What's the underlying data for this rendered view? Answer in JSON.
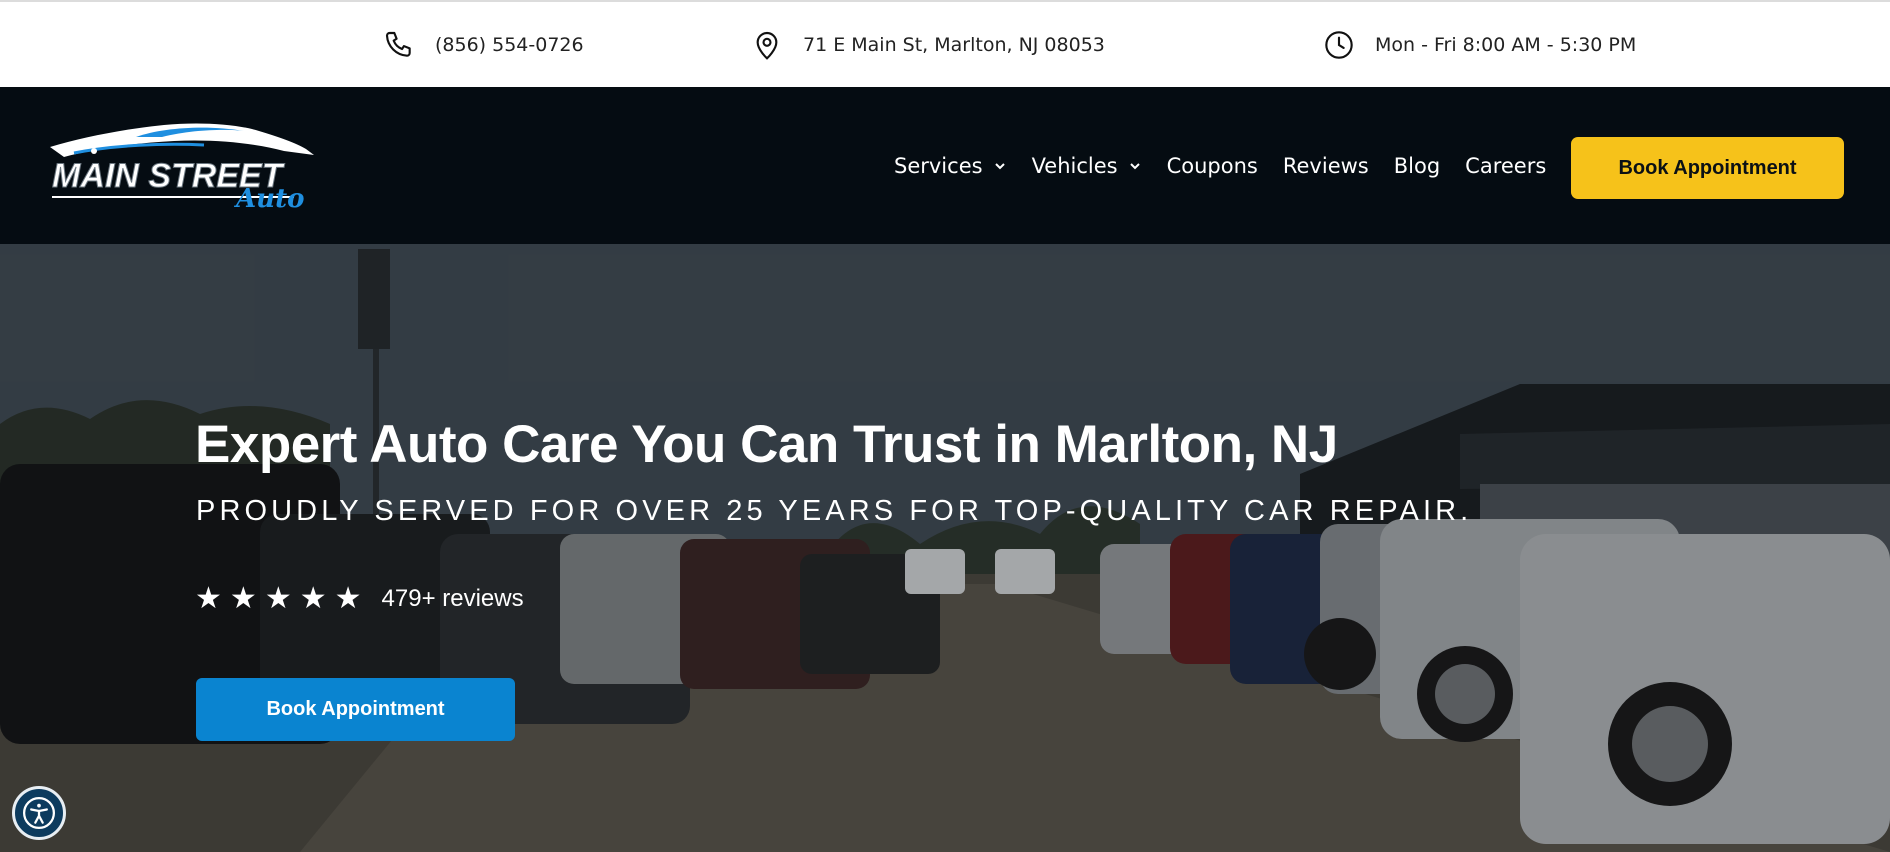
{
  "topbar": {
    "phone": "(856) 554-0726",
    "address": "71 E Main St, Marlton, NJ 08053",
    "hours": "Mon - Fri 8:00 AM - 5:30 PM",
    "icons": [
      "phone-icon",
      "map-pin-icon",
      "clock-icon"
    ]
  },
  "nav": {
    "logo": {
      "line1": "MAIN STREET",
      "line2": "Auto"
    },
    "items": [
      {
        "label": "Services",
        "has_dropdown": true
      },
      {
        "label": "Vehicles",
        "has_dropdown": true
      },
      {
        "label": "Coupons",
        "has_dropdown": false
      },
      {
        "label": "Reviews",
        "has_dropdown": false
      },
      {
        "label": "Blog",
        "has_dropdown": false
      },
      {
        "label": "Careers",
        "has_dropdown": false
      }
    ],
    "cta_label": "Book Appointment"
  },
  "hero": {
    "title": "Expert Auto Care You Can Trust in Marlton, NJ",
    "subtitle": "PROUDLY SERVED FOR OVER 25 YEARS FOR TOP-QUALITY CAR REPAIR.",
    "stars": 5,
    "star_glyph": "★",
    "reviews": "479+ reviews",
    "cta_label": "Book Appointment"
  },
  "colors": {
    "nav_bg": "#050c12",
    "nav_cta": "#f6c21a",
    "hero_cta": "#0a84d0",
    "logo_accent": "#1f8fe0"
  }
}
